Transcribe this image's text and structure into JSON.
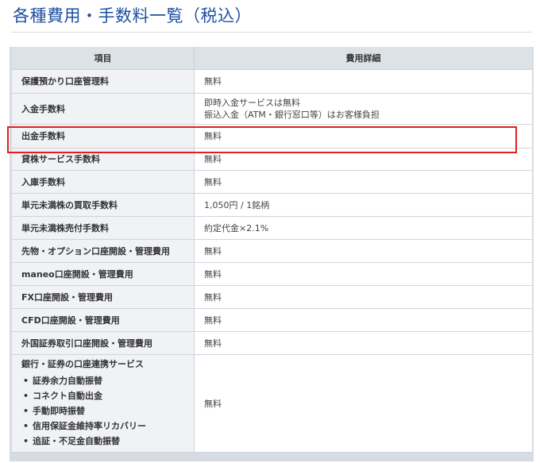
{
  "title": "各種費用・手数料一覧（税込）",
  "table": {
    "headers": {
      "item": "項目",
      "detail": "費用詳細"
    },
    "rows": [
      {
        "item": "保護預かり口座管理料",
        "detail": [
          "無料"
        ]
      },
      {
        "item": "入金手数料",
        "detail": [
          "即時入金サービスは無料",
          "振込入金（ATM・銀行窓口等）はお客様負担"
        ]
      },
      {
        "item": "出金手数料",
        "detail": [
          "無料"
        ]
      },
      {
        "item": "貸株サービス手数料",
        "detail": [
          "無料"
        ]
      },
      {
        "item": "入庫手数料",
        "detail": [
          "無料"
        ]
      },
      {
        "item": "単元未満株の買取手数料",
        "detail": [
          "1,050円 / 1銘柄"
        ]
      },
      {
        "item": "単元未満株売付手数料",
        "detail": [
          "約定代金×2.1%"
        ]
      },
      {
        "item": "先物・オプション口座開設・管理費用",
        "detail": [
          "無料"
        ]
      },
      {
        "item": "maneo口座開設・管理費用",
        "detail": [
          "無料"
        ]
      },
      {
        "item": "FX口座開設・管理費用",
        "detail": [
          "無料"
        ]
      },
      {
        "item": "CFD口座開設・管理費用",
        "detail": [
          "無料"
        ]
      },
      {
        "item": "外国証券取引口座開設・管理費用",
        "detail": [
          "無料"
        ]
      }
    ],
    "last_row": {
      "item": "銀行・証券の口座連携サービス",
      "bullets": [
        "証券余力自動振替",
        "コネクト自動出金",
        "手動即時振替",
        "信用保証金維持率リカバリー",
        "追証・不足金自動振替"
      ],
      "detail": "無料"
    }
  },
  "highlight": {
    "row": "出金手数料",
    "color": "#e02020"
  }
}
